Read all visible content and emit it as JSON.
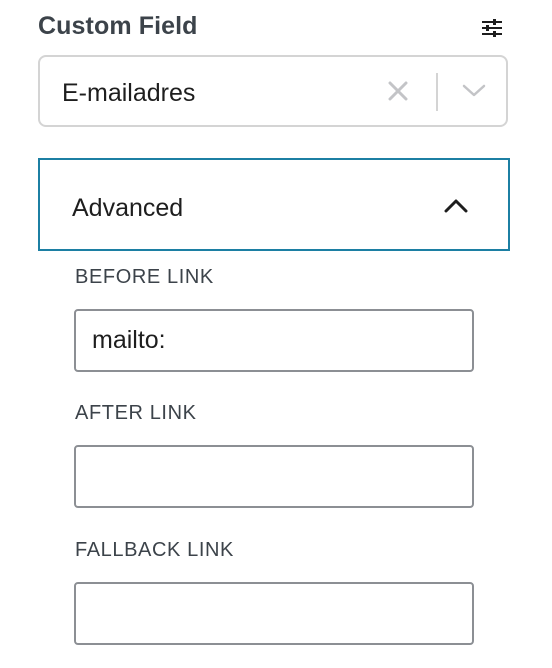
{
  "panel": {
    "title": "Custom Field"
  },
  "select": {
    "value": "E-mailadres"
  },
  "advanced": {
    "label": "Advanced"
  },
  "fields": {
    "before_link": {
      "label": "BEFORE LINK",
      "value": "mailto:"
    },
    "after_link": {
      "label": "AFTER LINK",
      "value": ""
    },
    "fallback_link": {
      "label": "FALLBACK LINK",
      "value": ""
    }
  },
  "icons": {
    "settings": "sliders-icon",
    "clear": "close-icon",
    "dropdown": "chevron-down-icon",
    "collapse": "chevron-up-icon"
  },
  "colors": {
    "focus_border": "#1c7fa3",
    "input_border": "#8c8f94",
    "select_border": "#d4d4d4",
    "muted_icon": "#c3c4c7"
  }
}
